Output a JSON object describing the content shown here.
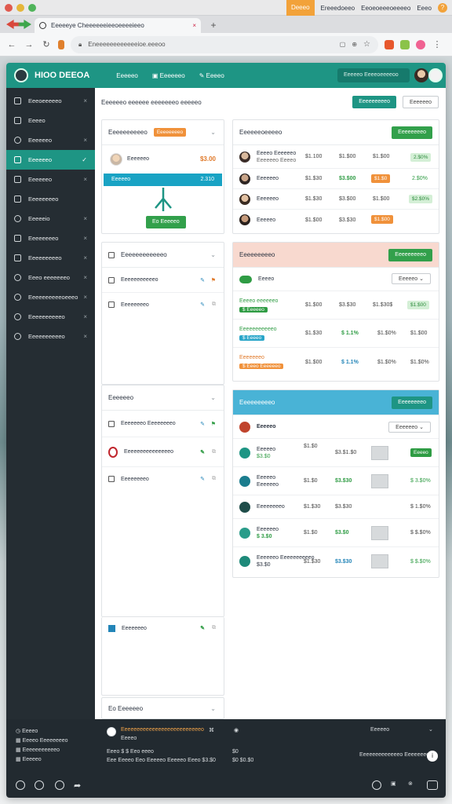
{
  "os": {
    "menu": [
      "Deeeo",
      "Ereeedoeeo",
      "Eeoeoeeeoeeeeo",
      "Eeeo"
    ]
  },
  "browser": {
    "tab_title": "Eeeeeye Cheeeeeeieeoeeeeieeo",
    "url": "Eneeeeeeeeeeeeioe.eeeoo"
  },
  "app": {
    "brand": "HIOO DEEOA",
    "nav": [
      "Eeeeeo",
      "Eeeeeeo",
      "Eeeeo"
    ],
    "search": "Eeeeeo Eeeeoeeeeoo"
  },
  "sidebar": {
    "items": [
      {
        "label": "Eeeoeeeeeo",
        "active": false
      },
      {
        "label": "Eeeeo",
        "active": false
      },
      {
        "label": "Eeeeeeo",
        "active": false
      },
      {
        "label": "Eeeeeeo",
        "active": true
      },
      {
        "label": "Eeeeeeo",
        "active": false
      },
      {
        "label": "Eeeeeeeeo",
        "active": false
      },
      {
        "label": "Eeeeeio",
        "active": false
      },
      {
        "label": "Eeeeeeeeo",
        "active": false
      },
      {
        "label": "Eeeeeeeeeo",
        "active": false
      },
      {
        "label": "Eeeo eeeeeeeo",
        "active": false
      },
      {
        "label": "Eeeeeeeeeeoeeeo",
        "active": false
      },
      {
        "label": "Eeeeeeeeeeo",
        "active": false
      },
      {
        "label": "Eeeeeeeeeeo",
        "active": false
      }
    ]
  },
  "toolbar": {
    "title": "Eeeeeeo eeeeee eeeeeeeo eeeeeo",
    "primary": "Eeeeeeeeeo",
    "secondary": "Eeeeeeo"
  },
  "panel_a": {
    "title": "Eeeeeeeeeeo",
    "badge": "Eeeeeeeeo",
    "name": "Eeeeeeo",
    "amount": "$3.00",
    "bar_label": "Eeeeeo",
    "bar_value": "2.310",
    "button": "Eo Eeeeeo"
  },
  "panel_b": {
    "title": "Eeeeeeoeeeeo",
    "button": "Eeeeeeeeo",
    "rows": [
      {
        "name": "Eeeeo Eeeeeeo",
        "sub": "Eeeeeeo Eeeeo",
        "a": "$1.100",
        "b": "$1.$00",
        "c": "$1.$00",
        "d": "2.$0%"
      },
      {
        "name": "Eeeeeeo",
        "sub": "",
        "a": "$1.$30",
        "b": "$3.$00",
        "c": "$1.$0",
        "d": "2.$0%"
      },
      {
        "name": "Eeeeeeo",
        "sub": "",
        "a": "$1.$30",
        "b": "$3.$00",
        "c": "$1.$00",
        "d": "$2.$0%"
      },
      {
        "name": "Eeeeeo",
        "sub": "",
        "a": "$1.$00",
        "b": "$3.$30",
        "c": "$1.$00",
        "d": ""
      }
    ]
  },
  "panel_c": {
    "title": "Eeeeeeeeeeeeo",
    "items": [
      "Eeeeeeeeeeeo",
      "Eeeeeeeeo"
    ]
  },
  "panel_d": {
    "title": "Eeeeeeeeeo",
    "button": "Eeeeeeeeeo",
    "select": "Eeeeeo",
    "first": "Eeeeo",
    "rows": [
      {
        "name": "Eeeeo eeeeeeo",
        "tag": "$ Eeeeeo",
        "a": "$1.$00",
        "b": "$3.$30",
        "c": "$1.$30$",
        "d": "$1.$00"
      },
      {
        "name": "Eeeeeeeeeeeo",
        "tag": "$ Eeeeo",
        "a": "$1.$30",
        "b": "$ 1.1%",
        "c": "$1.$0%",
        "d": "$1.$00"
      },
      {
        "name": "Eeeeeeeo",
        "tag": "$ Eeeo Eeeeeeo",
        "a": "$1.$00",
        "b": "$ 1.1%",
        "c": "$1.$0%",
        "d": "$1.$0%"
      }
    ]
  },
  "panel_e": {
    "title": "Eeeeeeo",
    "items": [
      "Eeeeeeeo Eeeeeeeeo",
      "Eeeeeeeeeeeeeeeo",
      "Eeeeeeeeo"
    ]
  },
  "panel_f": {
    "title": "Eeeeeeeeeo",
    "button": "Eeeeeeeeo",
    "select": "Eeeeeeo",
    "first": "Eeeeeo",
    "rows": [
      {
        "name": "Eeeeeo",
        "sub": "$3.$0",
        "a": "$1.$0",
        "b": "$3.$1.$0",
        "c": "$3.$30",
        "d": "Eeeeo"
      },
      {
        "name": "Eeeeeo",
        "sub": "Eeeeeeo",
        "a": "$1.$0",
        "b": "$3.$30",
        "c": "",
        "d": "$ 3.$0%"
      },
      {
        "name": "Eeeeeeeeo",
        "sub": "$ 3.$0",
        "a": "$1.$30",
        "b": "$3.$30",
        "c": "",
        "d": "$ 1.$0%"
      },
      {
        "name": "Eeeeeeo",
        "sub": "$ 3.$0",
        "a": "$1.$0",
        "b": "$3.$0",
        "c": "",
        "d": "$ $.$0%"
      },
      {
        "name": "Eeeeeeo Eeeeeeeeeeo",
        "sub": "$3.$0",
        "a": "$1.$30",
        "b": "$3.$30",
        "c": "",
        "d": "$ $.$0%"
      }
    ]
  },
  "panel_g": {
    "item": "Eeeeeeeo"
  },
  "panel_h": {
    "title": "Eo Eeeeeeo"
  },
  "bottom": {
    "left": [
      "Eeeeo",
      "Eeeeo Eeeeeeeeo",
      "Eeeeeeeeeeeo",
      "Eeeeeo"
    ],
    "msg": "Eeeeeeeeeeeeeeeeeeeeeeeeeeo",
    "msg_sub": "Eeeeo",
    "line1": "Eeeo $ $ Eeo eeeo",
    "line2": "Eee Eeeeo Eeo Eeeeeo Eeeeeo Eeeo $3.$0",
    "mid1": "$0",
    "mid2": "$0 $0.$0",
    "right_title": "Eeeeeo",
    "right_line": "Eeeeeeeeeeeeeo Eeeeeeeo"
  }
}
